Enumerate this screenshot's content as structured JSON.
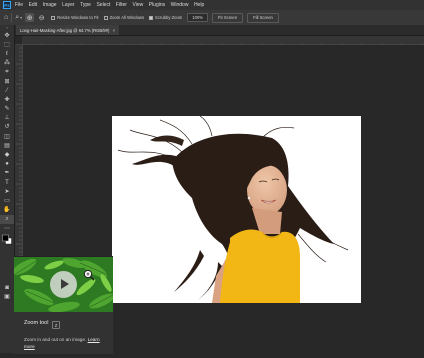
{
  "app": {
    "logo": "Ps",
    "menu": [
      "File",
      "Edit",
      "Image",
      "Layer",
      "Type",
      "Select",
      "Filter",
      "View",
      "Plugins",
      "Window",
      "Help"
    ]
  },
  "options": {
    "home_icon": "home-icon",
    "zoom_level_icon": "zoom-icon",
    "resize_windows_label": "Resize Windows to Fit",
    "zoom_all_windows_label": "Zoom All Windows",
    "scrubby_zoom_label": "Scrubby Zoom",
    "scrubby_zoom_checked": true,
    "zoom_value": "100%",
    "fit_screen_label": "Fit Screen",
    "fill_screen_label": "Fill Screen"
  },
  "document": {
    "tab_label": "Long-Hair-Masking-After.jpg @ 64.7% (RGB/8#)",
    "close_icon": "close-icon"
  },
  "tooltip": {
    "title": "Zoom tool",
    "shortcut": "Z",
    "description": "Zoom in and out on an image.",
    "link": "Learn more"
  },
  "colors": {
    "accent": "#31a8ff",
    "shirt": "#f3b715",
    "hair": "#2a1d16",
    "skin": "#e3b596",
    "leaves": "#2d7a22"
  }
}
